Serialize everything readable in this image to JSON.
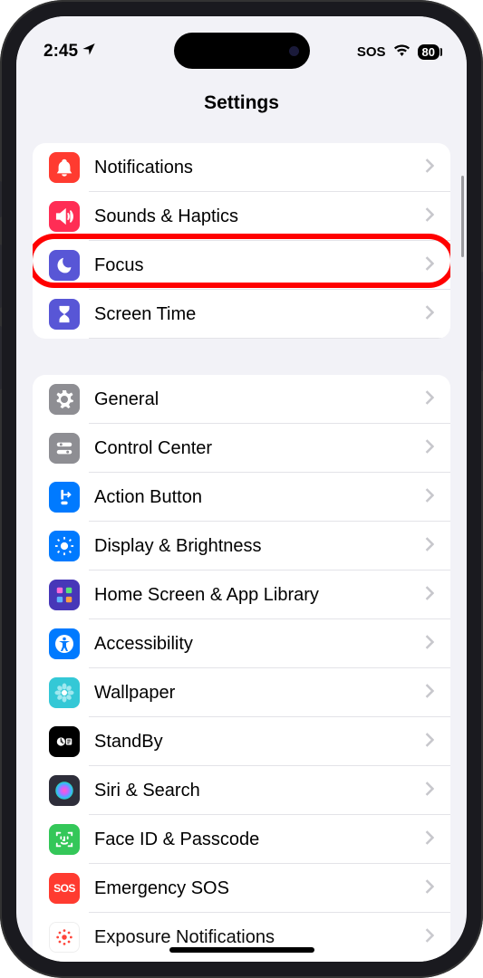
{
  "status": {
    "time": "2:45",
    "sos": "SOS",
    "battery": "80"
  },
  "header": {
    "title": "Settings"
  },
  "groups": [
    {
      "rows": [
        {
          "id": "notifications",
          "label": "Notifications",
          "bg": "#ff3b30",
          "icon": "bell"
        },
        {
          "id": "sounds-haptics",
          "label": "Sounds & Haptics",
          "bg": "#ff2d55",
          "icon": "speaker"
        },
        {
          "id": "focus",
          "label": "Focus",
          "bg": "#5856d6",
          "icon": "moon",
          "highlighted": true
        },
        {
          "id": "screen-time",
          "label": "Screen Time",
          "bg": "#5856d6",
          "icon": "hourglass"
        }
      ]
    },
    {
      "rows": [
        {
          "id": "general",
          "label": "General",
          "bg": "#8e8e93",
          "icon": "gear"
        },
        {
          "id": "control-center",
          "label": "Control Center",
          "bg": "#8e8e93",
          "icon": "switches"
        },
        {
          "id": "action-button",
          "label": "Action Button",
          "bg": "#007aff",
          "icon": "action"
        },
        {
          "id": "display-brightness",
          "label": "Display & Brightness",
          "bg": "#007aff",
          "icon": "sun"
        },
        {
          "id": "home-screen",
          "label": "Home Screen & App Library",
          "bg": "#4737b8",
          "icon": "grid"
        },
        {
          "id": "accessibility",
          "label": "Accessibility",
          "bg": "#007aff",
          "icon": "person"
        },
        {
          "id": "wallpaper",
          "label": "Wallpaper",
          "bg": "#34c8d6",
          "icon": "flower"
        },
        {
          "id": "standby",
          "label": "StandBy",
          "bg": "#000000",
          "icon": "standby"
        },
        {
          "id": "siri-search",
          "label": "Siri & Search",
          "bg": "#2e2e3a",
          "icon": "siri"
        },
        {
          "id": "face-id",
          "label": "Face ID & Passcode",
          "bg": "#34c759",
          "icon": "face"
        },
        {
          "id": "emergency-sos",
          "label": "Emergency SOS",
          "bg": "#ff3b30",
          "icon": "sos"
        },
        {
          "id": "exposure",
          "label": "Exposure Notifications",
          "bg": "#ffffff",
          "icon": "exposure"
        }
      ]
    }
  ]
}
